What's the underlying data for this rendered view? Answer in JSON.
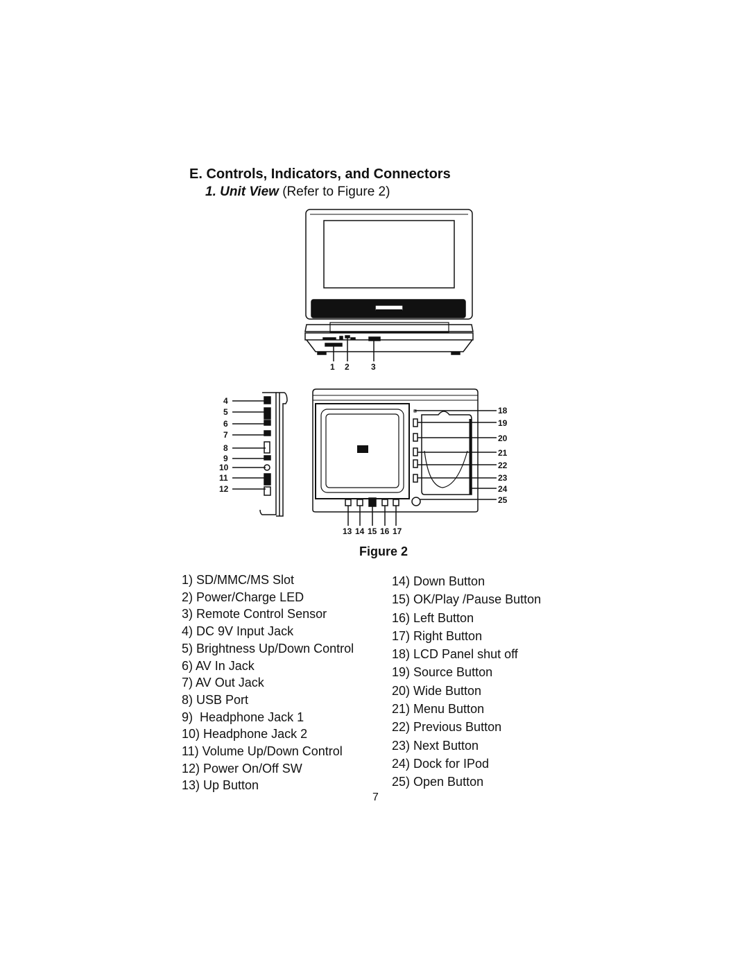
{
  "section": {
    "heading": "E. Controls, Indicators, and Connectors",
    "subheading_bold": "1. Unit View",
    "subheading_rest": " (Refer to Figure 2)"
  },
  "figure": {
    "caption": "Figure 2",
    "front_view_callouts": [
      "1",
      "2",
      "3"
    ],
    "side_view_callouts": [
      "4",
      "5",
      "6",
      "7",
      "8",
      "9",
      "10",
      "11",
      "12"
    ],
    "top_view_bottom_callouts": [
      "13",
      "14",
      "15",
      "16",
      "17"
    ],
    "top_view_right_callouts": [
      "18",
      "19",
      "20",
      "21",
      "22",
      "23",
      "24",
      "25"
    ]
  },
  "legend": {
    "left": [
      "1) SD/MMC/MS Slot",
      "2) Power/Charge LED",
      "3) Remote Control Sensor",
      "4) DC 9V Input Jack",
      "5) Brightness Up/Down Control",
      "6) AV In Jack",
      "7) AV Out Jack",
      "8) USB Port",
      "9)  Headphone Jack 1",
      "10) Headphone Jack 2",
      "11) Volume Up/Down Control",
      "12) Power On/Off SW",
      "13) Up Button"
    ],
    "right": [
      "14) Down Button",
      "15) OK/Play /Pause Button",
      "16) Left Button",
      "17) Right Button",
      "18) LCD Panel shut off",
      "19) Source Button",
      "20) Wide Button",
      "21) Menu Button",
      "22) Previous Button",
      "23) Next Button",
      "24) Dock for IPod",
      "25) Open Button"
    ]
  },
  "page_number": "7"
}
